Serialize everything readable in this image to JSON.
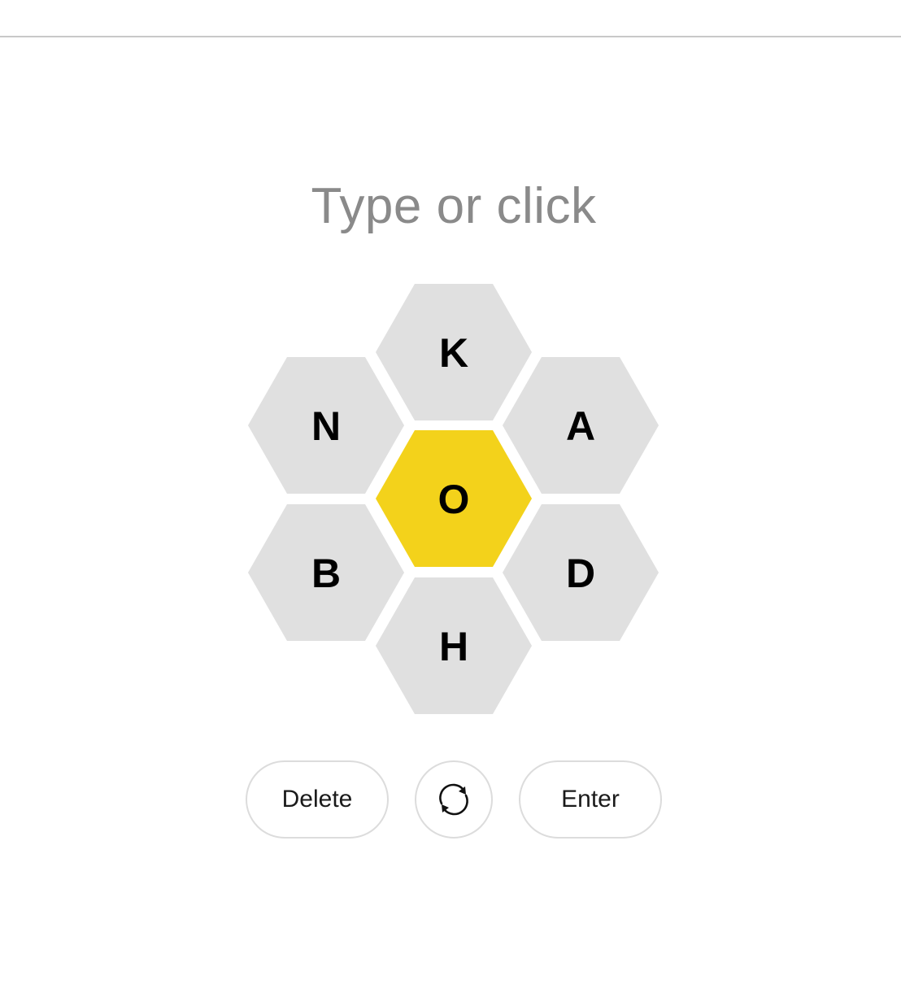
{
  "input": {
    "placeholder": "Type or click"
  },
  "hive": {
    "center_letter": "O",
    "outer_letters": {
      "top": "K",
      "upper_left": "N",
      "upper_right": "A",
      "lower_left": "B",
      "lower_right": "D",
      "bottom": "H"
    }
  },
  "controls": {
    "delete_label": "Delete",
    "enter_label": "Enter",
    "shuffle_icon": "shuffle-icon"
  },
  "colors": {
    "center_cell": "#f3d21b",
    "outer_cell": "#e0e0e0",
    "placeholder_text": "#8a8a8a",
    "button_border": "#dcdcdc"
  }
}
